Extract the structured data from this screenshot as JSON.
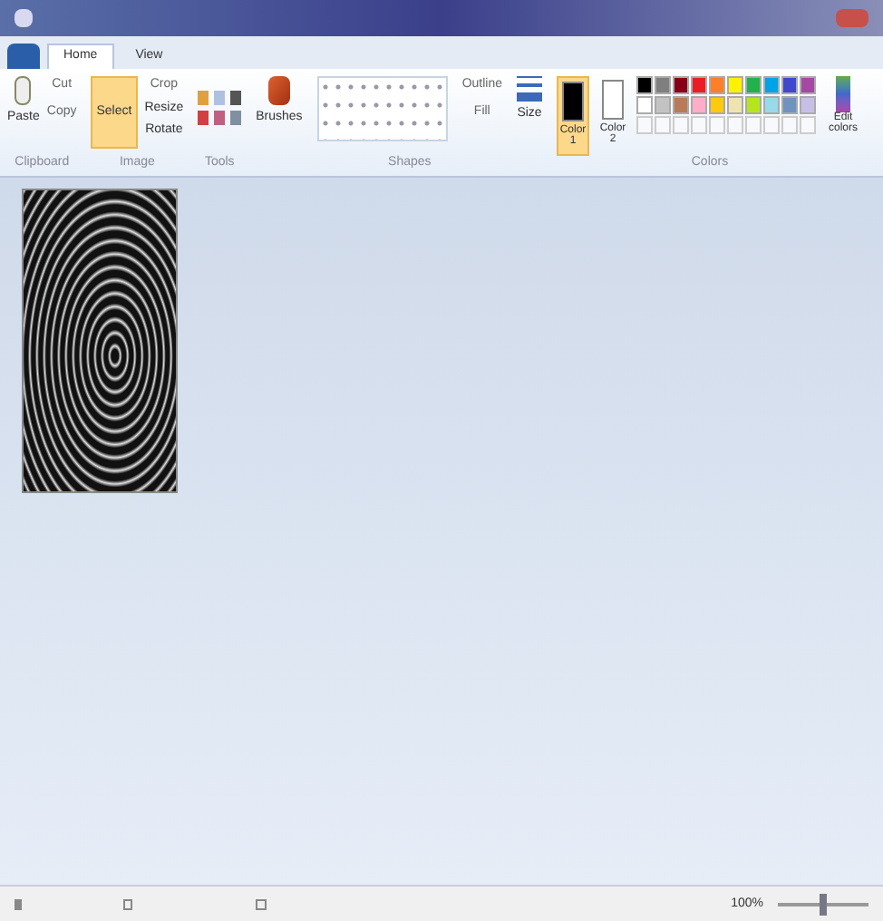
{
  "tabs": [
    {
      "label": "Home",
      "selected": true
    },
    {
      "label": "View",
      "selected": false
    }
  ],
  "ribbon": {
    "clipboard": {
      "paste": "Paste",
      "cut": "Cut",
      "copy": "Copy",
      "label": "Clipboard"
    },
    "image": {
      "select": "Select",
      "crop": "Crop",
      "resize": "Resize",
      "rotate": "Rotate",
      "label": "Image"
    },
    "tools": {
      "label": "Tools"
    },
    "brushes": "Brushes",
    "shapes": {
      "outline": "Outline",
      "fill": "Fill",
      "label": "Shapes"
    },
    "size": "Size",
    "colors": {
      "color1": {
        "label": "Color 1",
        "color": "#000000",
        "selected": true
      },
      "color2": {
        "label": "Color 2",
        "color": "#ffffff",
        "selected": false
      },
      "edit": "Edit colors",
      "label": "Colors",
      "palette": [
        {
          "color": "#000000"
        },
        {
          "color": "#7f7f7f"
        },
        {
          "color": "#880015"
        },
        {
          "color": "#ed1c24"
        },
        {
          "color": "#ff7f27"
        },
        {
          "color": "#fff200"
        },
        {
          "color": "#22b14c"
        },
        {
          "color": "#00a2e8"
        },
        {
          "color": "#3f48cc"
        },
        {
          "color": "#a349a4"
        },
        {
          "color": "#ffffff"
        },
        {
          "color": "#c3c3c3"
        },
        {
          "color": "#b97a57"
        },
        {
          "color": "#ffaec9"
        },
        {
          "color": "#ffc90e"
        },
        {
          "color": "#efe4b0"
        },
        {
          "color": "#b5e61d"
        },
        {
          "color": "#99d9ea"
        },
        {
          "color": "#7092be"
        },
        {
          "color": "#c8bfe7"
        }
      ]
    }
  },
  "status_bar": {
    "zoom": "100%",
    "zoom_slider": {
      "level": 0.5
    }
  }
}
